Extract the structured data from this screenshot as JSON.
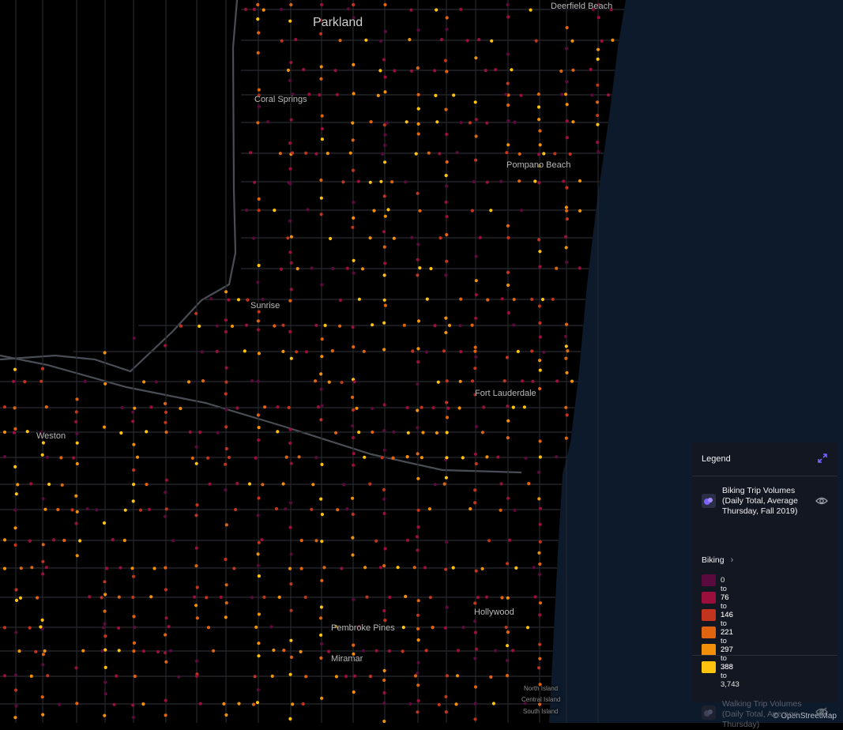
{
  "map": {
    "places": [
      {
        "name": "Parkland",
        "size": "big"
      },
      {
        "name": "Deerfield Beach",
        "size": "mid"
      },
      {
        "name": "Coral Springs",
        "size": "mid"
      },
      {
        "name": "Pompano Beach",
        "size": "mid"
      },
      {
        "name": "Sunrise",
        "size": "mid"
      },
      {
        "name": "Fort Lauderdale",
        "size": "mid"
      },
      {
        "name": "Weston",
        "size": "mid"
      },
      {
        "name": "Hollywood",
        "size": "mid"
      },
      {
        "name": "Pembroke Pines",
        "size": "mid"
      },
      {
        "name": "Miramar",
        "size": "mid"
      },
      {
        "name": "North Island",
        "size": "small"
      },
      {
        "name": "Central Island",
        "size": "small"
      },
      {
        "name": "South Island",
        "size": "small"
      }
    ],
    "attribution": "© OpenStreetMap",
    "colors": {
      "water": "#0d1a2b",
      "land": "#000000",
      "roads": "#3a3d44"
    }
  },
  "legend": {
    "title": "Legend",
    "collapse_icon": "collapse-arrows-icon",
    "layers": [
      {
        "title": "Biking Trip Volumes (Daily Total, Average Thursday, Fall 2019)",
        "icon": "point-layer-icon",
        "visibility_icon": "eye-icon",
        "visible": true,
        "mode_label": "Biking",
        "classes": [
          {
            "label": "0 to 76",
            "color": "#5b0a3e"
          },
          {
            "label": "76 to 146",
            "color": "#9a0f3c"
          },
          {
            "label": "146 to 221",
            "color": "#c2341d"
          },
          {
            "label": "221 to 297",
            "color": "#e0640f"
          },
          {
            "label": "297 to 388",
            "color": "#f3900a"
          },
          {
            "label": "388 to 3,743",
            "color": "#ffc20e"
          }
        ]
      },
      {
        "title": "Walking Trip Volumes (Daily Total, Average Thursday)",
        "icon": "point-layer-icon",
        "visibility_icon": "eye-off-icon",
        "visible": false
      }
    ]
  }
}
